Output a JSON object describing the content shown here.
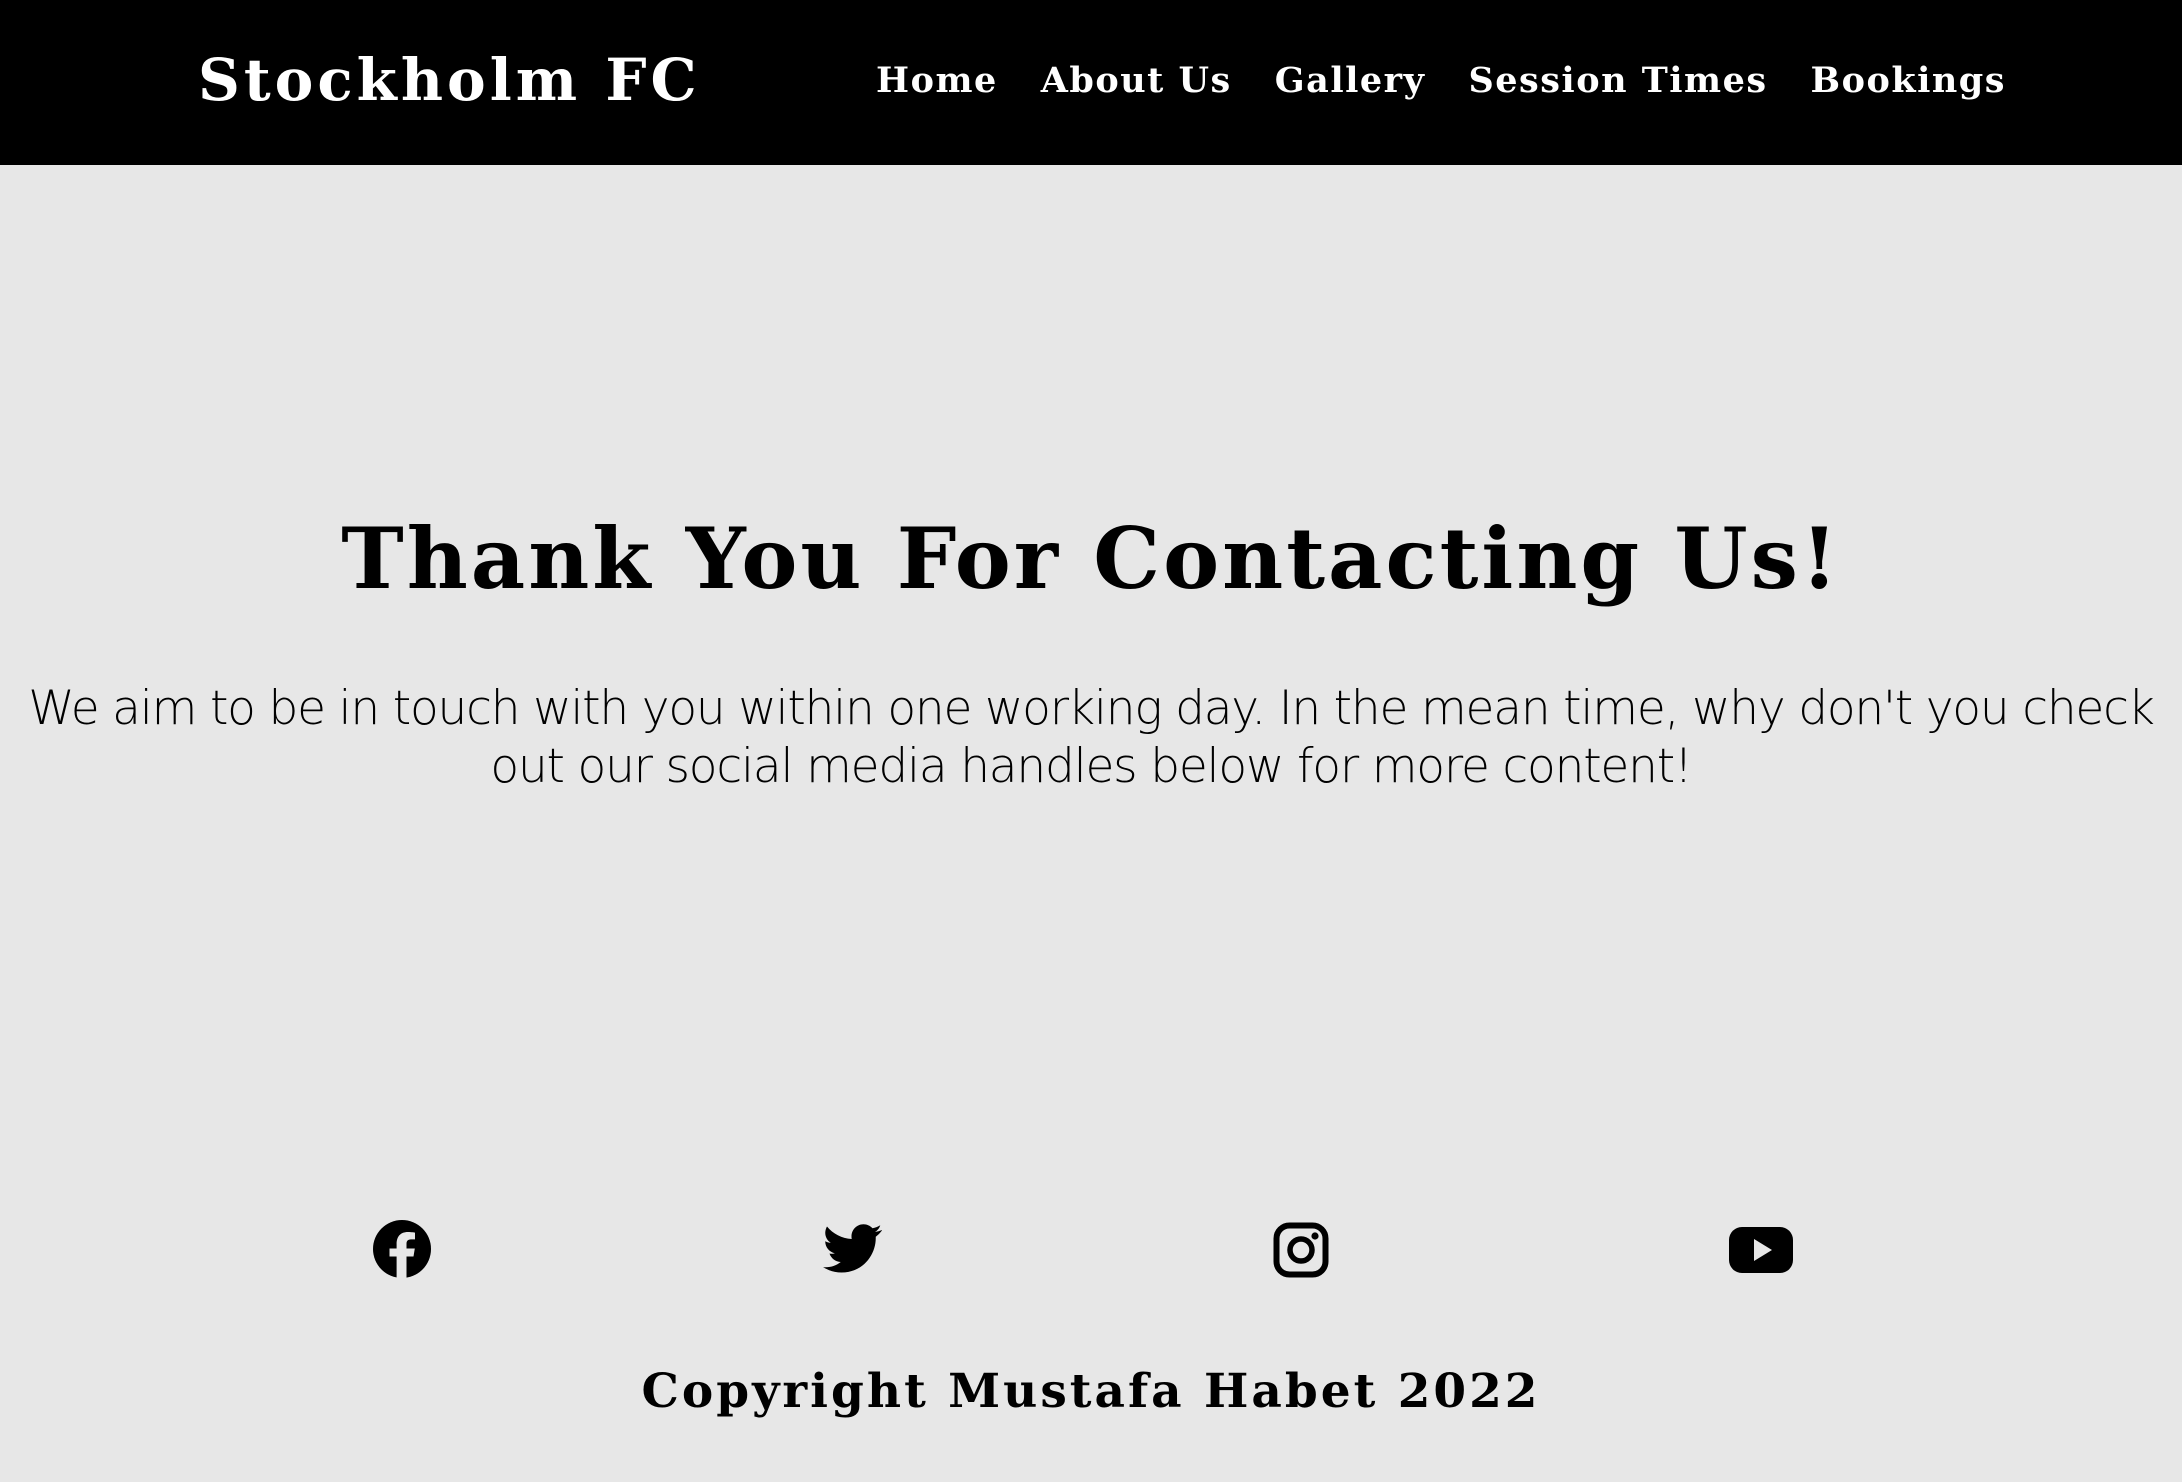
{
  "header": {
    "brand": "Stockholm FC",
    "nav": [
      {
        "label": "Home"
      },
      {
        "label": "About Us"
      },
      {
        "label": "Gallery"
      },
      {
        "label": "Session Times"
      },
      {
        "label": "Bookings"
      }
    ]
  },
  "main": {
    "title": "Thank You For Contacting Us!",
    "message": "We aim to be in touch with you within one working day. In the mean time, why don't you check out our social media handles below for more content!"
  },
  "socials": [
    {
      "icon": "facebook-icon"
    },
    {
      "icon": "twitter-icon"
    },
    {
      "icon": "instagram-icon"
    },
    {
      "icon": "youtube-icon"
    }
  ],
  "footer": {
    "copyright": "Copyright Mustafa Habet 2022"
  },
  "colors": {
    "header_bg": "#000000",
    "page_bg": "#e7e7e7",
    "text": "#000000",
    "nav_text": "#ffffff"
  }
}
